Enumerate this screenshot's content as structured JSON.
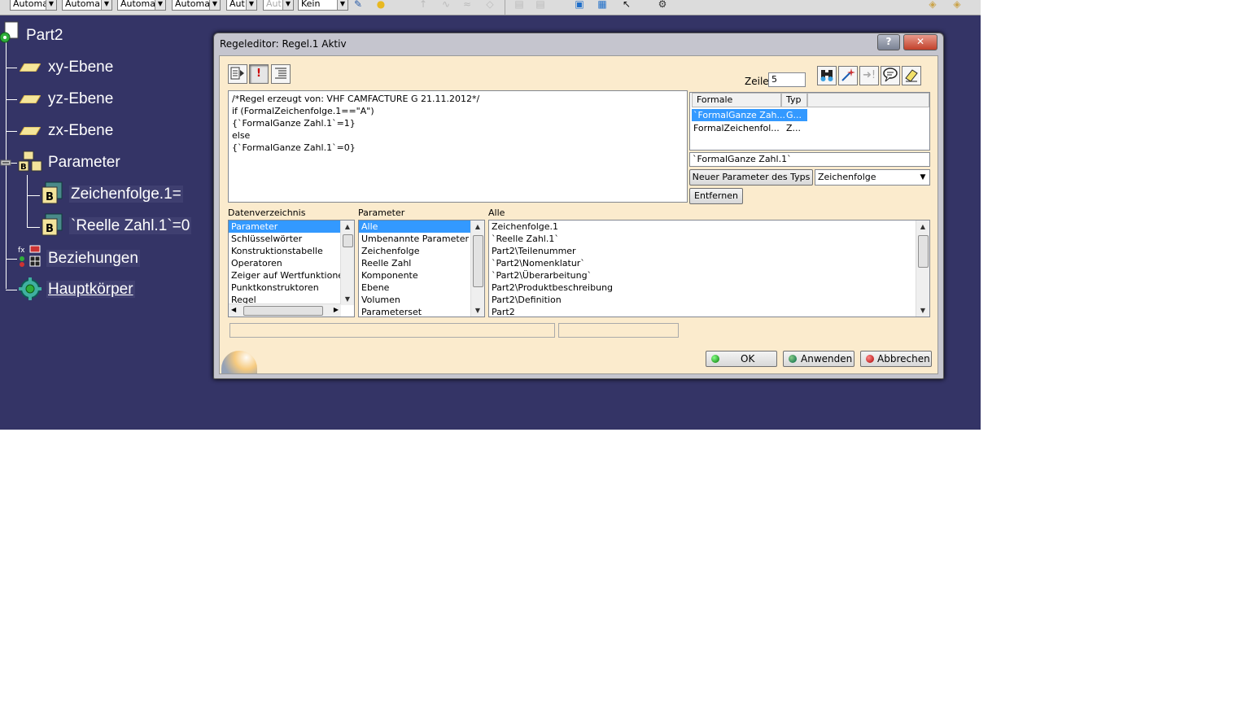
{
  "toolbar": {
    "combos": [
      "Automa",
      "Automa",
      "Automa",
      "Automa",
      "Aut",
      "Aut",
      "Kein"
    ]
  },
  "tree": {
    "root": "Part2",
    "items": [
      {
        "label": "xy-Ebene"
      },
      {
        "label": "yz-Ebene"
      },
      {
        "label": "zx-Ebene"
      },
      {
        "label": "Parameter"
      },
      {
        "label": "Zeichenfolge.1="
      },
      {
        "label": "`Reelle Zahl.1`=0"
      },
      {
        "label": "Beziehungen"
      },
      {
        "label": "Hauptkörper"
      }
    ]
  },
  "dialog": {
    "title": "Regeleditor: Regel.1 Aktiv",
    "help": "?",
    "close": "✕",
    "code_lines": [
      "/*Regel erzeugt von: VHF CAMFACTURE G 21.11.2012*/",
      "if (FormalZeichenfolge.1==\"A\")",
      "{`FormalGanze Zahl.1`=1}",
      "else",
      "{`FormalGanze Zahl.1`=0}"
    ],
    "zeile_label": "Zeile:",
    "zeile_value": "5",
    "formal_table": {
      "headers": [
        "Formale Parameter",
        "Typ"
      ],
      "rows": [
        {
          "name": "`FormalGanze Zah...",
          "type": "G..."
        },
        {
          "name": "FormalZeichenfol...",
          "type": "Z..."
        }
      ]
    },
    "param_name": "`FormalGanze Zahl.1`",
    "new_param_button": "Neuer Parameter des Typs",
    "type_select": "Zeichenfolge",
    "remove_button": "Entfernen",
    "dictionary": {
      "label": "Datenverzeichnis",
      "items": [
        "Parameter",
        "Schlüsselwörter",
        "Konstruktionstabelle",
        "Operatoren",
        "Zeiger auf Wertfunktionen",
        "Punktkonstruktoren",
        "Regel"
      ]
    },
    "parameters": {
      "label": "Parameter",
      "items": [
        "Alle",
        "Umbenannte Parameter",
        "Zeichenfolge",
        "Reelle Zahl",
        "Komponente",
        "Ebene",
        "Volumen",
        "Parameterset"
      ]
    },
    "all": {
      "label": "Alle",
      "items": [
        "Zeichenfolge.1",
        "`Reelle Zahl.1`",
        "Part2\\Teilenummer",
        "`Part2\\Nomenklatur`",
        "`Part2\\Überarbeitung`",
        "Part2\\Produktbeschreibung",
        "Part2\\Definition",
        "Part2"
      ]
    },
    "ok": "OK",
    "apply": "Anwenden",
    "cancel": "Abbrechen"
  }
}
